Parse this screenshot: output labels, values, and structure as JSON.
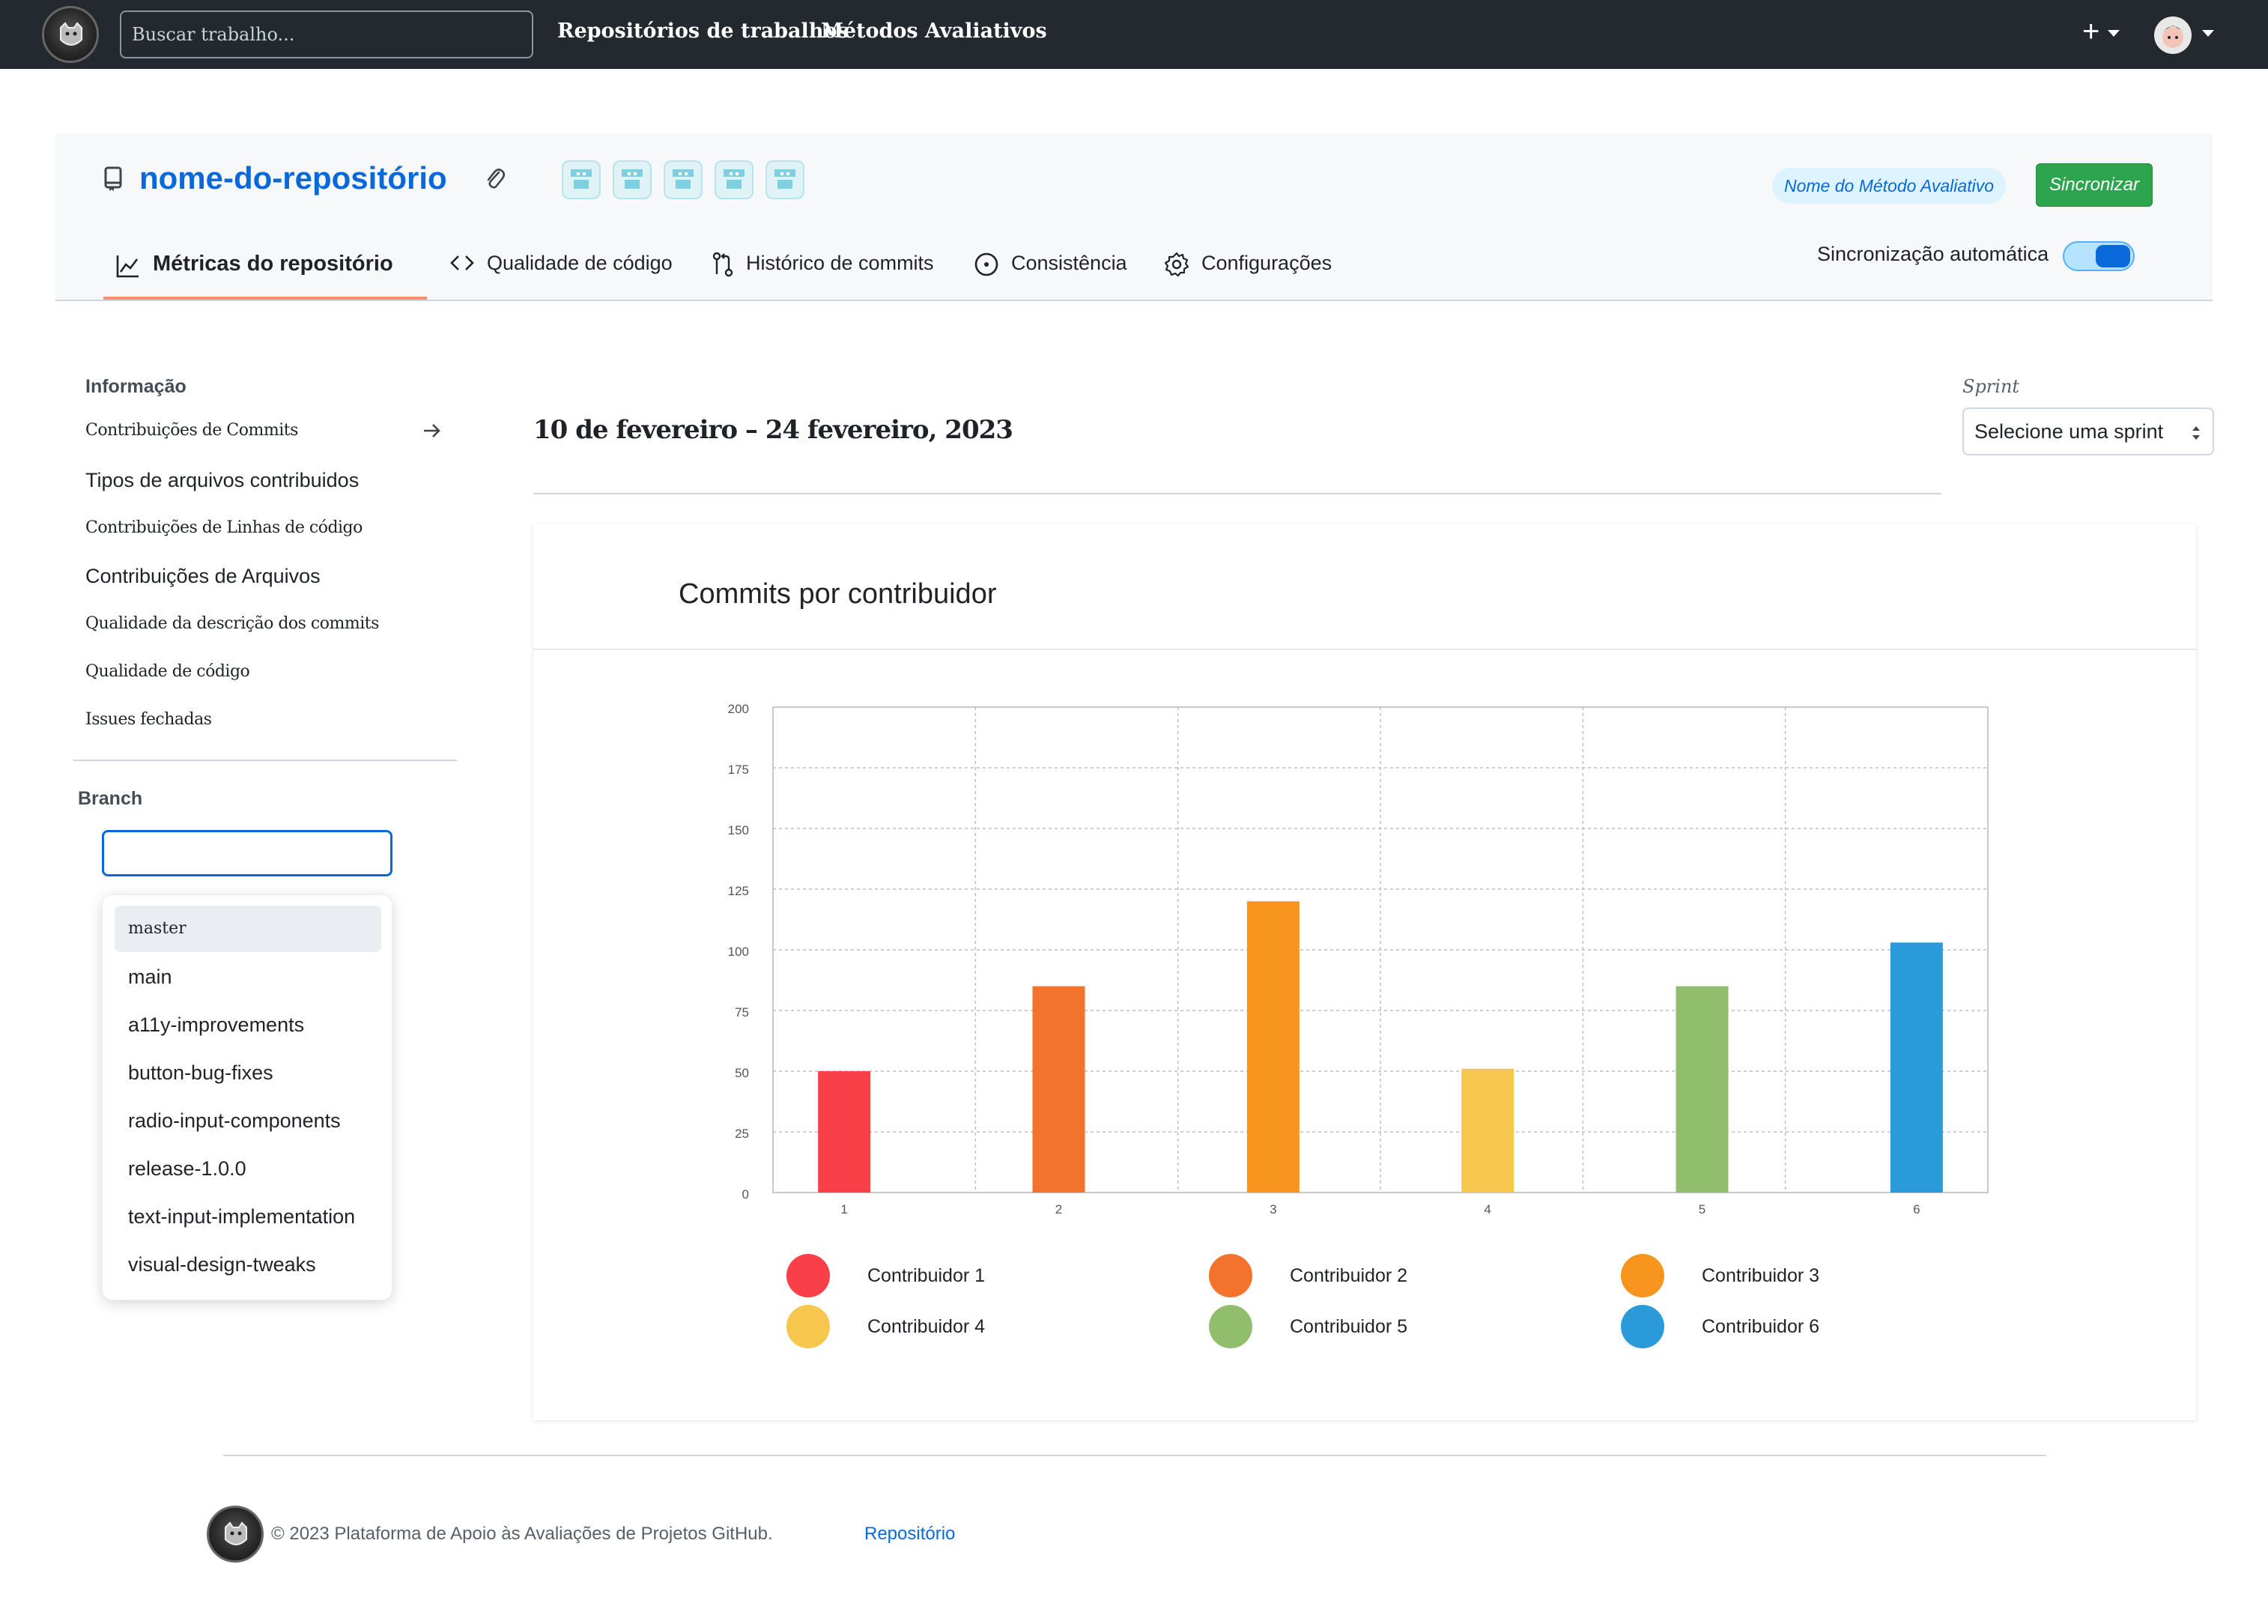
{
  "nav": {
    "search_placeholder": "Buscar trabalho...",
    "links": [
      "Repositórios de trabalhos",
      "Métodos Avaliativos"
    ],
    "plus": "+"
  },
  "repo": {
    "name": "nome-do-repositório",
    "method_badge": "Nome do Método Avaliativo",
    "sync_button": "Sincronizar",
    "auto_sync_label": "Sincronização automática",
    "auto_sync_on": true,
    "tabs": [
      {
        "label": "Métricas do repositório",
        "icon": "graph-icon",
        "active": true
      },
      {
        "label": "Qualidade de código",
        "icon": "code-icon",
        "active": false
      },
      {
        "label": "Histórico de commits",
        "icon": "git-compare-icon",
        "active": false
      },
      {
        "label": "Consistência",
        "icon": "dot-circle-icon",
        "active": false
      },
      {
        "label": "Configurações",
        "icon": "gear-icon",
        "active": false
      }
    ]
  },
  "sidebar": {
    "info_title": "Informação",
    "items": [
      "Contribuições de Commits",
      "Tipos de arquivos contribuidos",
      "Contribuições de Linhas de código",
      "Contribuições de Arquivos",
      "Qualidade da descrição dos commits",
      "Qualidade de código",
      "Issues fechadas"
    ],
    "branch_title": "Branch",
    "branch_value": "",
    "branches": [
      "master",
      "main",
      "a11y-improvements",
      "button-bug-fixes",
      "radio-input-components",
      "release-1.0.0",
      "text-input-implementation",
      "visual-design-tweaks"
    ]
  },
  "main": {
    "date_range": "10 de fevereiro – 24 fevereiro, 2023",
    "sprint_label": "Sprint",
    "sprint_select": "Selecione uma sprint",
    "card_title": "Commits por contribuidor"
  },
  "chart_data": {
    "type": "bar",
    "categories": [
      "1",
      "2",
      "3",
      "4",
      "5",
      "6"
    ],
    "values": [
      50,
      85,
      120,
      51,
      85,
      103
    ],
    "colors": [
      "#f93f47",
      "#f2722e",
      "#f7951f",
      "#f7c64d",
      "#90be6d",
      "#2b9ad8"
    ],
    "yticks": [
      0,
      25,
      50,
      75,
      100,
      125,
      150,
      175,
      200
    ],
    "ylim": [
      0,
      200
    ],
    "grid": true,
    "legend": [
      "Contribuidor 1",
      "Contribuidor 2",
      "Contribuidor 3",
      "Contribuidor 4",
      "Contribuidor 5",
      "Contribuidor 6"
    ],
    "legend_placement": "bottom"
  },
  "footer": {
    "text": "© 2023 Plataforma de Apoio às Avaliações de Projetos GitHub.",
    "link": "Repositório"
  }
}
